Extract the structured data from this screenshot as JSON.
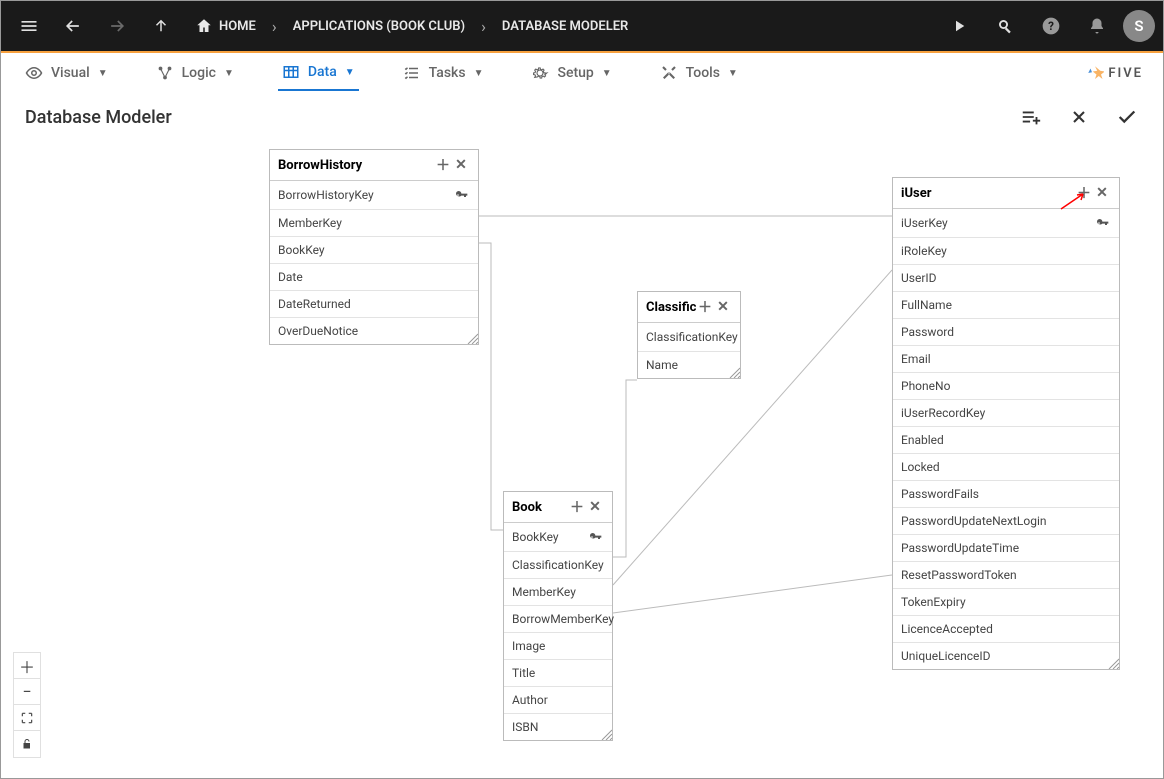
{
  "topbar": {
    "home_label": "HOME",
    "breadcrumbs": [
      "APPLICATIONS (BOOK CLUB)",
      "DATABASE MODELER"
    ],
    "avatar_initial": "S"
  },
  "menubar": {
    "items": [
      {
        "label": "Visual",
        "active": false
      },
      {
        "label": "Logic",
        "active": false
      },
      {
        "label": "Data",
        "active": true
      },
      {
        "label": "Tasks",
        "active": false
      },
      {
        "label": "Setup",
        "active": false
      },
      {
        "label": "Tools",
        "active": false
      }
    ],
    "brand": "FIVE"
  },
  "page": {
    "title": "Database Modeler"
  },
  "tables": {
    "borrow_history": {
      "name": "BorrowHistory",
      "fields": [
        {
          "name": "BorrowHistoryKey",
          "pk": true
        },
        {
          "name": "MemberKey",
          "pk": false
        },
        {
          "name": "BookKey",
          "pk": false
        },
        {
          "name": "Date",
          "pk": false
        },
        {
          "name": "DateReturned",
          "pk": false
        },
        {
          "name": "OverDueNotice",
          "pk": false
        }
      ]
    },
    "classification": {
      "name": "Classificat",
      "fields": [
        {
          "name": "ClassificationKey",
          "pk": true
        },
        {
          "name": "Name",
          "pk": false
        }
      ]
    },
    "iuser": {
      "name": "iUser",
      "fields": [
        {
          "name": "iUserKey",
          "pk": true
        },
        {
          "name": "iRoleKey",
          "pk": false
        },
        {
          "name": "UserID",
          "pk": false
        },
        {
          "name": "FullName",
          "pk": false
        },
        {
          "name": "Password",
          "pk": false
        },
        {
          "name": "Email",
          "pk": false
        },
        {
          "name": "PhoneNo",
          "pk": false
        },
        {
          "name": "iUserRecordKey",
          "pk": false
        },
        {
          "name": "Enabled",
          "pk": false
        },
        {
          "name": "Locked",
          "pk": false
        },
        {
          "name": "PasswordFails",
          "pk": false
        },
        {
          "name": "PasswordUpdateNextLogin",
          "pk": false
        },
        {
          "name": "PasswordUpdateTime",
          "pk": false
        },
        {
          "name": "ResetPasswordToken",
          "pk": false
        },
        {
          "name": "TokenExpiry",
          "pk": false
        },
        {
          "name": "LicenceAccepted",
          "pk": false
        },
        {
          "name": "UniqueLicenceID",
          "pk": false
        }
      ]
    },
    "book": {
      "name": "Book",
      "fields": [
        {
          "name": "BookKey",
          "pk": true
        },
        {
          "name": "ClassificationKey",
          "pk": false
        },
        {
          "name": "MemberKey",
          "pk": false
        },
        {
          "name": "BorrowMemberKey",
          "pk": false
        },
        {
          "name": "Image",
          "pk": false
        },
        {
          "name": "Title",
          "pk": false
        },
        {
          "name": "Author",
          "pk": false
        },
        {
          "name": "ISBN",
          "pk": false
        }
      ]
    }
  }
}
